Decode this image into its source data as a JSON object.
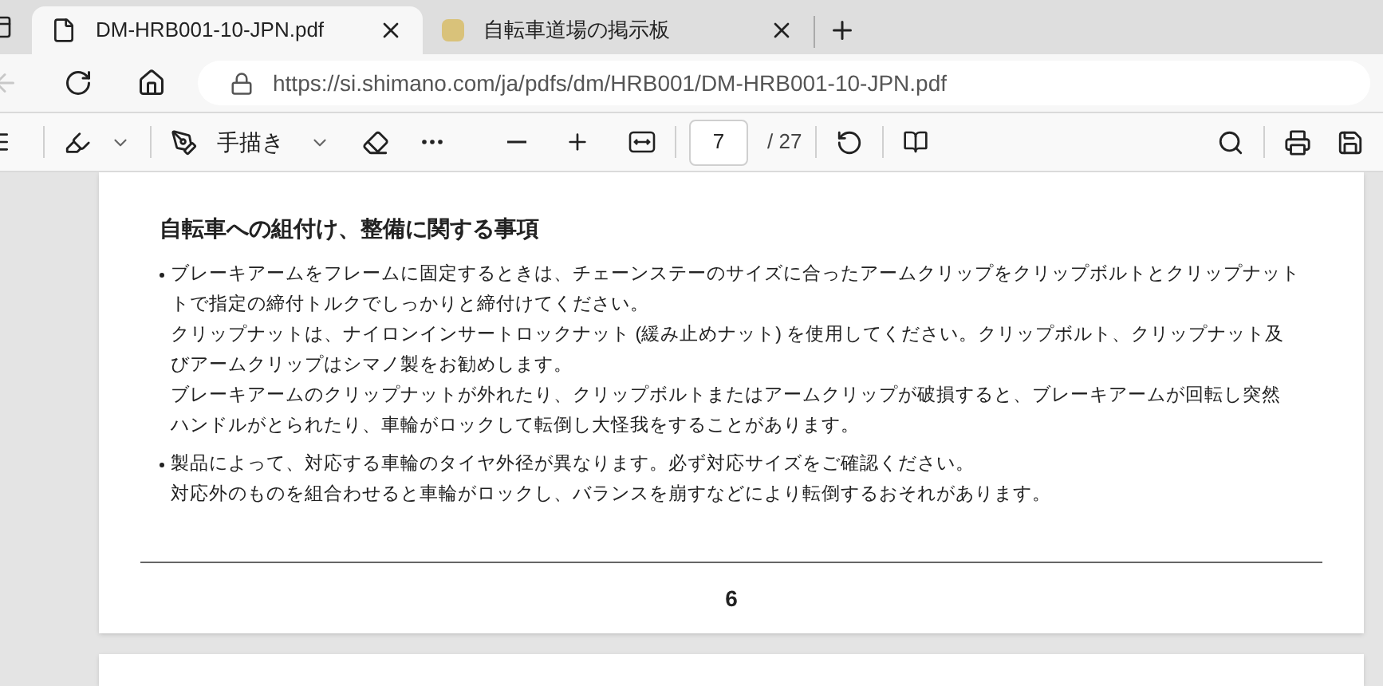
{
  "tabs": [
    {
      "title": "DM-HRB001-10-JPN.pdf",
      "selected": true,
      "kind": "pdf"
    },
    {
      "title": "自転車道場の掲示板",
      "selected": false,
      "kind": "site"
    }
  ],
  "address_bar": {
    "url": "https://si.shimano.com/ja/pdfs/dm/HRB001/DM-HRB001-10-JPN.pdf",
    "back_disabled": true
  },
  "pdf_toolbar": {
    "draw_label": "手描き",
    "page_number": "7",
    "page_total": "/ 27"
  },
  "page": {
    "heading": "自転車への組付け、整備に関する事項",
    "bullets": [
      {
        "lines": [
          "ブレーキアームをフレームに固定するときは、チェーンステーのサイズに合ったアームクリップをクリップボルトとクリップナット",
          "トで指定の締付トルクでしっかりと締付けてください。",
          "クリップナットは、ナイロンインサートロックナット (緩み止めナット) を使用してください。クリップボルト、クリップナット及",
          "びアームクリップはシマノ製をお勧めします。",
          "ブレーキアームのクリップナットが外れたり、クリップボルトまたはアームクリップが破損すると、ブレーキアームが回転し突然",
          "ハンドルがとられたり、車輪がロックして転倒し大怪我をすることがあります。"
        ]
      },
      {
        "lines": [
          "製品によって、対応する車輪のタイヤ外径が異なります。必ず対応サイズをご確認ください。",
          "対応外のものを組合わせると車輪がロックし、バランスを崩すなどにより転倒するおそれがあります。"
        ]
      }
    ],
    "page_number": "6"
  }
}
